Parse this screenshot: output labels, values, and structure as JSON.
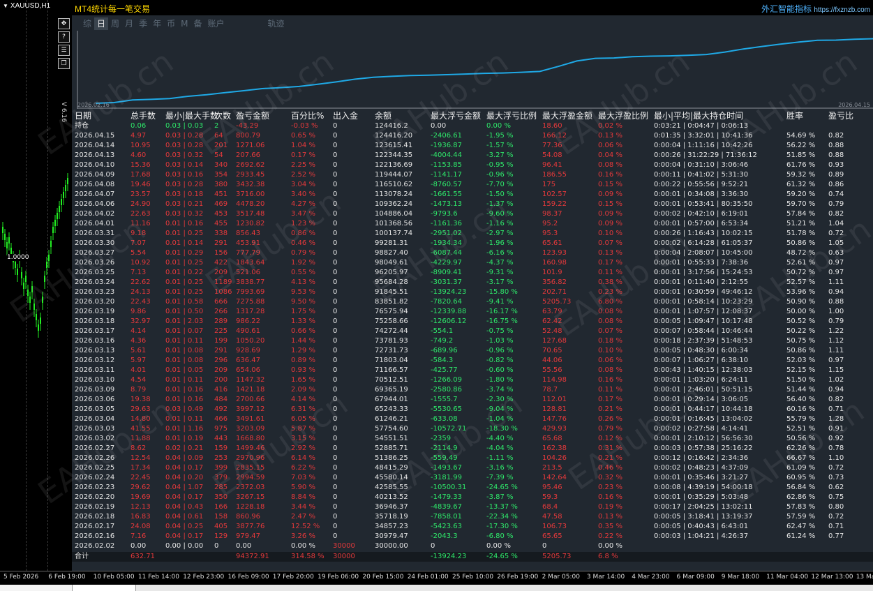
{
  "chart_window": {
    "symbol": "XAUUSD,H1",
    "version": "V 6.16",
    "toolbar_icons": [
      "move-icon",
      "help-icon",
      "menu-icon",
      "restore-icon"
    ],
    "price_label": "1.0000"
  },
  "panel": {
    "title": "MT4统计每一笔交易",
    "brand": "外汇智能指标",
    "brand_url": "https://fxznzb.com",
    "tabs": [
      "综",
      "日",
      "周",
      "月",
      "季",
      "年",
      "币",
      "M",
      "备",
      "账户",
      "轨迹"
    ],
    "active_tab": "日",
    "chart_start_date": "2026.02.16",
    "chart_end_date": "2026.04.15"
  },
  "colors": {
    "red": "#e5393b",
    "green": "#2ee86a",
    "line": "#1fa9e6",
    "title": "#ffd700"
  },
  "table": {
    "headers": [
      "日期",
      "总手数",
      "最小|最大手数",
      "次数",
      "盈亏金额",
      "百分比%",
      "出入金",
      "余额",
      "最大浮亏金额",
      "最大浮亏比例",
      "最大浮盈金额",
      "最大浮盈比例",
      "最小|平均|最大持仓时间",
      "胜率",
      "盈亏比"
    ],
    "position_row": [
      "持仓",
      "0.06",
      "0.03 | 0.03",
      "2",
      "-43.29",
      "-0.03 %",
      "0",
      "124416.2",
      "0.00",
      "0.00 %",
      "18.60",
      "0.02 %",
      "0:03:21 | 0:04:47 | 0:06:13",
      "",
      ""
    ],
    "rows": [
      [
        "2026.04.15",
        "4.97",
        "0.03 | 0.28",
        "64",
        "800.79",
        "0.65 %",
        "0",
        "124416.20",
        "-2406.61",
        "-1.95 %",
        "166.12",
        "0.13 %",
        "0:01:35 | 3:32:01 | 10:41:36",
        "54.69 %",
        "0.82"
      ],
      [
        "2026.04.14",
        "10.95",
        "0.03 | 0.28",
        "201",
        "1271.06",
        "1.04 %",
        "0",
        "123615.41",
        "-1936.87",
        "-1.57 %",
        "77.36",
        "0.06 %",
        "0:00:04 | 1:11:16 | 10:42:26",
        "56.22 %",
        "0.88"
      ],
      [
        "2026.04.13",
        "4.60",
        "0.03 | 0.32",
        "54",
        "207.66",
        "0.17 %",
        "0",
        "122344.35",
        "-4004.44",
        "-3.27 %",
        "54.08",
        "0.04 %",
        "0:00:26 | 31:22:29 | 71:36:12",
        "51.85 %",
        "0.88"
      ],
      [
        "2026.04.10",
        "15.36",
        "0.03 | 0.14",
        "340",
        "2692.62",
        "2.25 %",
        "0",
        "122136.69",
        "-1153.85",
        "-0.95 %",
        "96.41",
        "0.08 %",
        "0:00:04 | 0:31:10 | 3:06:46",
        "61.76 %",
        "0.93"
      ],
      [
        "2026.04.09",
        "17.68",
        "0.03 | 0.16",
        "354",
        "2933.45",
        "2.52 %",
        "0",
        "119444.07",
        "-1141.17",
        "-0.96 %",
        "186.55",
        "0.16 %",
        "0:00:11 | 0:41:02 | 5:31:30",
        "59.32 %",
        "0.89"
      ],
      [
        "2026.04.08",
        "19.46",
        "0.03 | 0.28",
        "380",
        "3432.38",
        "3.04 %",
        "0",
        "116510.62",
        "-8760.57",
        "-7.70 %",
        "175",
        "0.15 %",
        "0:00:22 | 0:55:56 | 9:52:21",
        "61.32 %",
        "0.86"
      ],
      [
        "2026.04.07",
        "23.57",
        "0.03 | 0.18",
        "451",
        "3716.00",
        "3.40 %",
        "0",
        "113078.24",
        "-1661.55",
        "-1.50 %",
        "102.57",
        "0.09 %",
        "0:00:01 | 0:34:08 | 3:36:30",
        "59.20 %",
        "0.74"
      ],
      [
        "2026.04.06",
        "24.90",
        "0.03 | 0.21",
        "469",
        "4478.20",
        "4.27 %",
        "0",
        "109362.24",
        "-1473.13",
        "-1.37 %",
        "159.22",
        "0.15 %",
        "0:00:01 | 0:53:41 | 80:35:50",
        "59.70 %",
        "0.79"
      ],
      [
        "2026.04.02",
        "22.63",
        "0.03 | 0.32",
        "453",
        "3517.48",
        "3.47 %",
        "0",
        "104886.04",
        "-9793.6",
        "-9.60 %",
        "98.37",
        "0.09 %",
        "0:00:02 | 0:42:10 | 6:19:01",
        "57.84 %",
        "0.82"
      ],
      [
        "2026.04.01",
        "11.16",
        "0.01 | 0.16",
        "455",
        "1230.82",
        "1.23 %",
        "0",
        "101368.56",
        "-1161.36",
        "-1.16 %",
        "95.2",
        "0.09 %",
        "0:00:01 | 0:57:00 | 6:53:34",
        "51.21 %",
        "1.04"
      ],
      [
        "2026.03.31",
        "9.18",
        "0.01 | 0.25",
        "338",
        "856.43",
        "0.86 %",
        "0",
        "100137.74",
        "-2951.02",
        "-2.97 %",
        "95.3",
        "0.10 %",
        "0:00:26 | 1:16:43 | 10:02:15",
        "51.78 %",
        "0.72"
      ],
      [
        "2026.03.30",
        "7.07",
        "0.01 | 0.14",
        "291",
        "453.91",
        "0.46 %",
        "0",
        "99281.31",
        "-1934.34",
        "-1.96 %",
        "65.61",
        "0.07 %",
        "0:00:02 | 6:14:28 | 61:05:37",
        "50.86 %",
        "1.05"
      ],
      [
        "2026.03.27",
        "5.54",
        "0.01 | 0.29",
        "156",
        "777.79",
        "0.79 %",
        "0",
        "98827.40",
        "-6087.44",
        "-6.16 %",
        "123.93",
        "0.13 %",
        "0:00:04 | 2:08:07 | 10:45:00",
        "48.72 %",
        "0.63"
      ],
      [
        "2026.03.26",
        "10.92",
        "0.01 | 0.25",
        "422",
        "1843.64",
        "1.92 %",
        "0",
        "98049.61",
        "-4229.97",
        "-4.37 %",
        "160.98",
        "0.17 %",
        "0:00:01 | 0:55:33 | 7:38:36",
        "52.61 %",
        "0.97"
      ],
      [
        "2026.03.25",
        "7.13",
        "0.01 | 0.22",
        "209",
        "521.06",
        "0.55 %",
        "0",
        "96205.97",
        "-8909.41",
        "-9.31 %",
        "101.9",
        "0.11 %",
        "0:00:01 | 3:17:56 | 15:24:53",
        "50.72 %",
        "0.97"
      ],
      [
        "2026.03.24",
        "22.62",
        "0.01 | 0.25",
        "1189",
        "3838.77",
        "4.13 %",
        "0",
        "95684.28",
        "-3031.37",
        "-3.17 %",
        "356.82",
        "0.38 %",
        "0:00:01 | 0:11:40 | 2:12:55",
        "52.57 %",
        "1.11"
      ],
      [
        "2026.03.23",
        "24.13",
        "0.01 | 0.25",
        "1086",
        "7993.69",
        "9.53 %",
        "0",
        "91845.51",
        "-13924.23",
        "-15.80 %",
        "202.71",
        "0.23 %",
        "0:00:01 | 0:30:59 | 49:46:12",
        "53.96 %",
        "0.94"
      ],
      [
        "2026.03.20",
        "22.43",
        "0.01 | 0.58",
        "666",
        "7275.88",
        "9.50 %",
        "0",
        "83851.82",
        "-7820.64",
        "-9.41 %",
        "5205.73",
        "6.80 %",
        "0:00:01 | 0:58:14 | 10:23:29",
        "50.90 %",
        "0.88"
      ],
      [
        "2026.03.19",
        "9.86",
        "0.01 | 0.50",
        "266",
        "1317.28",
        "1.75 %",
        "0",
        "76575.94",
        "-12339.88",
        "-16.17 %",
        "63.79",
        "0.08 %",
        "0:00:01 | 1:07:57 | 12:08:37",
        "50.00 %",
        "1.00"
      ],
      [
        "2026.03.18",
        "32.97",
        "0.01 | 2.03",
        "289",
        "986.22",
        "1.33 %",
        "0",
        "75258.66",
        "-12606.12",
        "-16.75 %",
        "62.42",
        "0.08 %",
        "0:00:05 | 1:09:47 | 10:17:48",
        "50.52 %",
        "0.79"
      ],
      [
        "2026.03.17",
        "4.14",
        "0.01 | 0.07",
        "225",
        "490.61",
        "0.66 %",
        "0",
        "74272.44",
        "-554.1",
        "-0.75 %",
        "52.48",
        "0.07 %",
        "0:00:07 | 0:58:44 | 10:46:44",
        "50.22 %",
        "1.22"
      ],
      [
        "2026.03.16",
        "4.36",
        "0.01 | 0.11",
        "199",
        "1050.20",
        "1.44 %",
        "0",
        "73781.93",
        "-749.2",
        "-1.03 %",
        "127.68",
        "0.18 %",
        "0:00:18 | 2:37:39 | 51:48:53",
        "50.75 %",
        "1.12"
      ],
      [
        "2026.03.13",
        "5.61",
        "0.01 | 0.08",
        "291",
        "928.69",
        "1.29 %",
        "0",
        "72731.73",
        "-689.96",
        "-0.96 %",
        "70.65",
        "0.10 %",
        "0:00:05 | 0:48:30 | 6:00:34",
        "50.86 %",
        "1.11"
      ],
      [
        "2026.03.12",
        "5.97",
        "0.01 | 0.08",
        "296",
        "636.47",
        "0.89 %",
        "0",
        "71803.04",
        "-584.3",
        "-0.82 %",
        "44.06",
        "0.06 %",
        "0:00:07 | 1:06:27 | 6:38:10",
        "52.03 %",
        "0.97"
      ],
      [
        "2026.03.11",
        "4.01",
        "0.01 | 0.05",
        "209",
        "654.06",
        "0.93 %",
        "0",
        "71166.57",
        "-425.77",
        "-0.60 %",
        "55.56",
        "0.08 %",
        "0:00:43 | 1:40:15 | 12:38:03",
        "52.15 %",
        "1.15"
      ],
      [
        "2026.03.10",
        "4.54",
        "0.01 | 0.11",
        "200",
        "1147.32",
        "1.65 %",
        "0",
        "70512.51",
        "-1266.09",
        "-1.80 %",
        "114.98",
        "0.16 %",
        "0:00:01 | 1:03:20 | 6:24:11",
        "51.50 %",
        "1.02"
      ],
      [
        "2026.03.09",
        "8.79",
        "0.01 | 0.16",
        "416",
        "1421.18",
        "2.09 %",
        "0",
        "69365.19",
        "-2580.86",
        "-3.74 %",
        "78.7",
        "0.11 %",
        "0:00:01 | 2:46:01 | 50:51:15",
        "51.44 %",
        "0.94"
      ],
      [
        "2026.03.06",
        "19.38",
        "0.01 | 0.16",
        "484",
        "2700.66",
        "4.14 %",
        "0",
        "67944.01",
        "-1555.7",
        "-2.30 %",
        "112.01",
        "0.17 %",
        "0:00:01 | 0:29:14 | 3:06:05",
        "56.40 %",
        "0.82"
      ],
      [
        "2026.03.05",
        "29.63",
        "0.03 | 0.49",
        "492",
        "3997.12",
        "6.31 %",
        "0",
        "65243.33",
        "-5530.65",
        "-9.04 %",
        "128.81",
        "0.21 %",
        "0:00:01 | 0:44:17 | 10:44:18",
        "60.16 %",
        "0.71"
      ],
      [
        "2026.03.04",
        "14.80",
        "0.01 | 0.11",
        "466",
        "3491.61",
        "6.05 %",
        "0",
        "61246.21",
        "-633.08",
        "-1.04 %",
        "147.76",
        "0.26 %",
        "0:00:01 | 0:16:45 | 13:04:02",
        "55.79 %",
        "1.28"
      ],
      [
        "2026.03.03",
        "41.55",
        "0.01 | 1.16",
        "975",
        "3203.09",
        "5.87 %",
        "0",
        "57754.60",
        "-10572.71",
        "-18.30 %",
        "429.93",
        "0.79 %",
        "0:00:02 | 0:27:58 | 4:14:41",
        "52.51 %",
        "0.91"
      ],
      [
        "2026.03.02",
        "11.88",
        "0.01 | 0.19",
        "443",
        "1668.80",
        "3.15 %",
        "0",
        "54551.51",
        "-2359",
        "-4.40 %",
        "65.68",
        "0.12 %",
        "0:00:01 | 2:10:12 | 56:56:30",
        "50.56 %",
        "0.92"
      ],
      [
        "2026.02.27",
        "8.62",
        "0.02 | 0.21",
        "159",
        "1499.46",
        "2.92 %",
        "0",
        "52885.71",
        "-2114.9",
        "-4.04 %",
        "162.38",
        "0.31 %",
        "0:00:03 | 0:57:38 | 25:16:22",
        "62.26 %",
        "0.78"
      ],
      [
        "2026.02.26",
        "12.54",
        "0.04 | 0.09",
        "253",
        "2970.96",
        "6.14 %",
        "0",
        "51386.25",
        "-559.49",
        "-1.11 %",
        "104.26",
        "0.21 %",
        "0:00:12 | 0:16:42 | 2:34:36",
        "66.67 %",
        "1.10"
      ],
      [
        "2026.02.25",
        "17.34",
        "0.04 | 0.17",
        "399",
        "2835.15",
        "6.22 %",
        "0",
        "48415.29",
        "-1493.67",
        "-3.16 %",
        "213.5",
        "0.46 %",
        "0:00:02 | 0:48:23 | 4:37:09",
        "61.09 %",
        "0.72"
      ],
      [
        "2026.02.24",
        "22.45",
        "0.04 | 0.20",
        "379",
        "2994.59",
        "7.03 %",
        "0",
        "45580.14",
        "-3181.99",
        "-7.39 %",
        "142.64",
        "0.32 %",
        "0:00:01 | 0:35:46 | 3:21:27",
        "60.95 %",
        "0.73"
      ],
      [
        "2026.02.23",
        "29.62",
        "0.04 | 1.07",
        "285",
        "2372.03",
        "5.90 %",
        "0",
        "42585.55",
        "-10500.31",
        "-24.65 %",
        "95.46",
        "0.23 %",
        "0:00:08 | 4:39:19 | 54:00:18",
        "56.84 %",
        "0.62"
      ],
      [
        "2026.02.20",
        "19.69",
        "0.04 | 0.17",
        "350",
        "3267.15",
        "8.84 %",
        "0",
        "40213.52",
        "-1479.33",
        "-3.87 %",
        "59.3",
        "0.16 %",
        "0:00:01 | 0:35:29 | 5:03:48",
        "62.86 %",
        "0.75"
      ],
      [
        "2026.02.19",
        "12.13",
        "0.04 | 0.43",
        "166",
        "1228.18",
        "3.44 %",
        "0",
        "36946.37",
        "-4839.67",
        "-13.37 %",
        "68.4",
        "0.19 %",
        "0:00:17 | 2:04:25 | 13:02:11",
        "57.83 %",
        "0.80"
      ],
      [
        "2026.02.18",
        "16.83",
        "0.04 | 0.61",
        "158",
        "860.96",
        "2.47 %",
        "0",
        "35718.19",
        "-7858.01",
        "-22.34 %",
        "47.58",
        "0.13 %",
        "0:00:05 | 3:18:41 | 13:19:37",
        "57.59 %",
        "0.72"
      ],
      [
        "2026.02.17",
        "24.08",
        "0.04 | 0.25",
        "405",
        "3877.76",
        "12.52 %",
        "0",
        "34857.23",
        "-5423.63",
        "-17.30 %",
        "106.73",
        "0.35 %",
        "0:00:05 | 0:40:43 | 6:43:01",
        "62.47 %",
        "0.71"
      ],
      [
        "2026.02.16",
        "7.16",
        "0.04 | 0.17",
        "129",
        "979.47",
        "3.26 %",
        "0",
        "30979.47",
        "-2043.3",
        "-6.80 %",
        "65.65",
        "0.22 %",
        "0:00:03 | 1:04:21 | 4:26:37",
        "61.24 %",
        "0.77"
      ],
      [
        "2026.02.02",
        "0.00",
        "0.00 | 0.00",
        "0",
        "0.00",
        "0.00 %",
        "30000",
        "30000.00",
        "0",
        "0.00 %",
        "0",
        "0.00 %",
        "",
        "",
        ""
      ]
    ],
    "total_row": [
      "合计",
      "632.71",
      "",
      "",
      "94372.91",
      "314.58 %",
      "30000",
      "",
      "-13924.23",
      "-24.65 %",
      "5205.73",
      "6.8 %",
      "",
      "",
      ""
    ]
  },
  "time_axis": [
    "5 Feb 2026",
    "6 Feb 19:00",
    "10 Feb 05:00",
    "11 Feb 14:00",
    "12 Feb 23:00",
    "16 Feb 09:00",
    "17 Feb 20:00",
    "19 Feb 06:00",
    "20 Feb 15:00",
    "24 Feb 01:00",
    "25 Feb 10:00",
    "26 Feb 19:00",
    "2 Mar 05:00",
    "3 Mar 14:00",
    "4 Mar 23:00",
    "6 Mar 09:00",
    "9 Mar 18:00",
    "11 Mar 04:00",
    "12 Mar 13:00",
    "13 Mar"
  ],
  "watermark": "EAHub.cn"
}
